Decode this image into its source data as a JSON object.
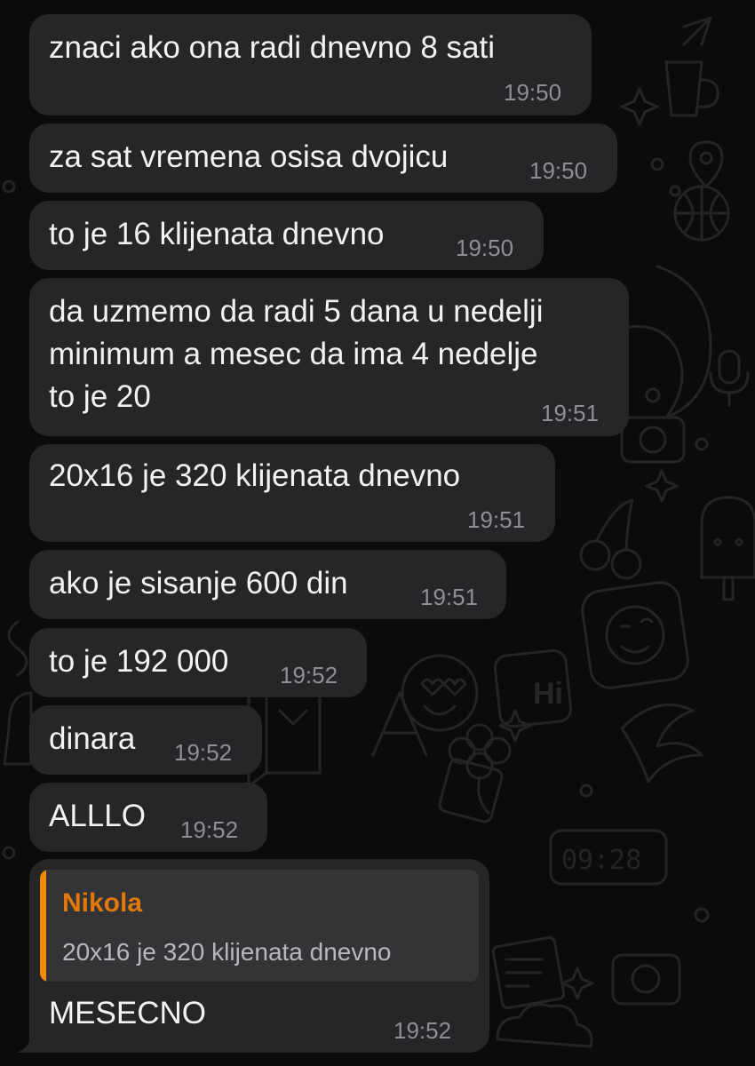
{
  "conversation": {
    "messages": [
      {
        "text": "znaci ako ona radi dnevno 8 sati",
        "time": "19:50"
      },
      {
        "text": "za sat vremena osisa dvojicu",
        "time": "19:50"
      },
      {
        "text": "to je 16 klijenata dnevno",
        "time": "19:50"
      },
      {
        "text": "da uzmemo da radi 5 dana u nedelji\nminimum a mesec da ima 4 nedelje\nto je 20",
        "time": "19:51"
      },
      {
        "text": "20x16 je 320 klijenata dnevno",
        "time": "19:51"
      },
      {
        "text": "ako je sisanje 600 din",
        "time": "19:51"
      },
      {
        "text": "to je 192 000",
        "time": "19:52"
      },
      {
        "text": "dinara",
        "time": "19:52"
      },
      {
        "text": "ALLLO",
        "time": "19:52"
      },
      {
        "reply_to": {
          "author": "Nikola",
          "text": "20x16 je 320 klijenata dnevno"
        },
        "text": "MESECNO",
        "time": "19:52"
      }
    ]
  },
  "wallpaper": {
    "doodles": [
      "hi-sticker",
      "digital-clock",
      "camera-icon",
      "letter-a",
      "heart-eyes-emoji",
      "wink-emoji",
      "cloud-icon",
      "ice-cream",
      "envelope-icon",
      "clover",
      "microphone-icon",
      "basketball"
    ],
    "hi_label": "Hi",
    "clock_label": "09:28",
    "letter_label": "A"
  },
  "colors": {
    "background": "#0b0b0b",
    "bubble": "#262628",
    "quote_background": "#343436",
    "quote_accent": "#f08c0a",
    "author_name": "#e1780c",
    "timestamp": "#8e8e93",
    "message_text": "#f2f2f2"
  }
}
